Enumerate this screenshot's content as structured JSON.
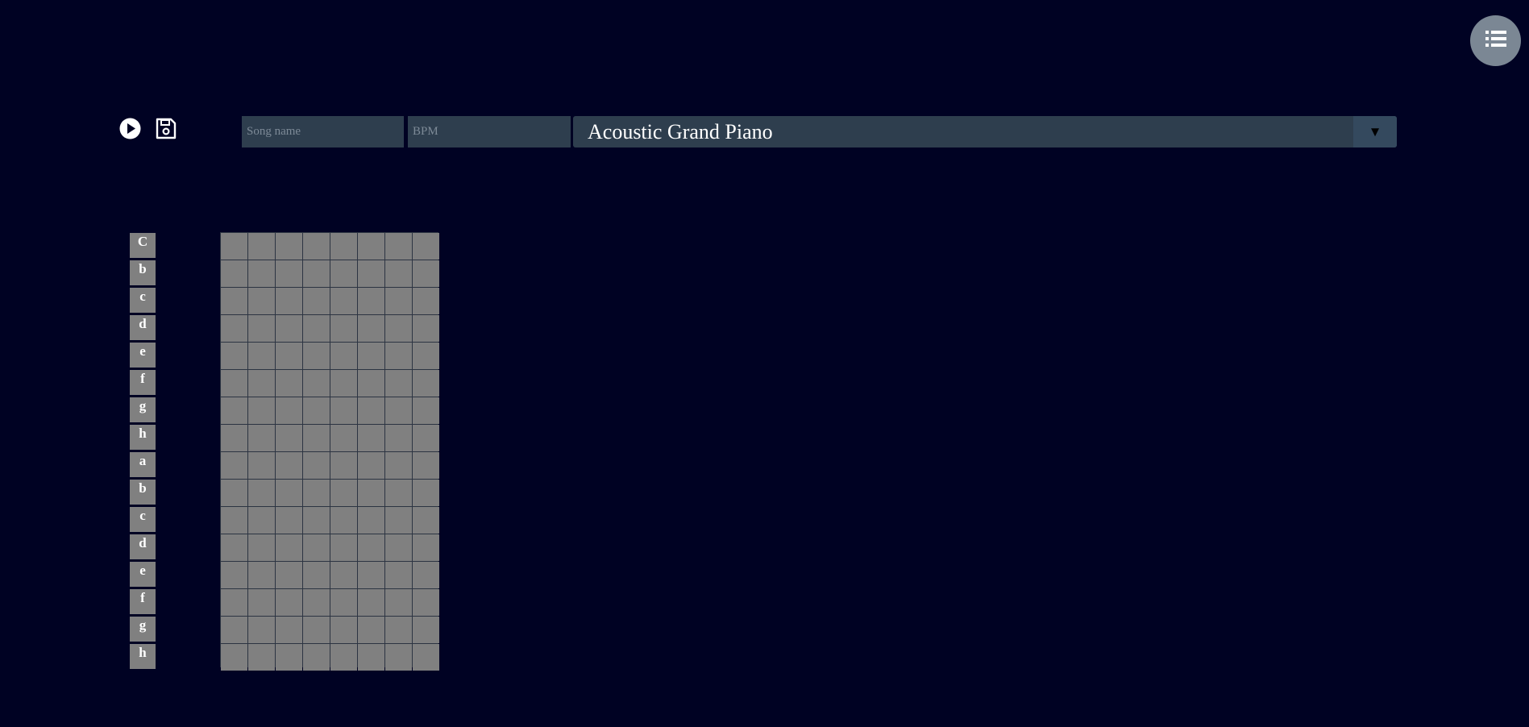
{
  "toolbar": {
    "play_icon": "play-circle-icon",
    "save_icon": "floppy-disk-icon",
    "menu_icon": "list-icon"
  },
  "inputs": {
    "song_name": {
      "placeholder": "Song name",
      "value": ""
    },
    "bpm": {
      "placeholder": "BPM",
      "value": ""
    }
  },
  "instrument_select": {
    "selected": "Acoustic Grand Piano",
    "arrow": "▼"
  },
  "notes": [
    "C",
    "b",
    "c",
    "d",
    "e",
    "f",
    "g",
    "h",
    "a",
    "b",
    "c",
    "d",
    "e",
    "f",
    "g",
    "h"
  ],
  "grid": {
    "columns": 8,
    "rows": 16
  },
  "colors": {
    "background": "#000223",
    "field": "#2e3e4e",
    "cell": "#808080",
    "menu_button": "#7b8794"
  }
}
